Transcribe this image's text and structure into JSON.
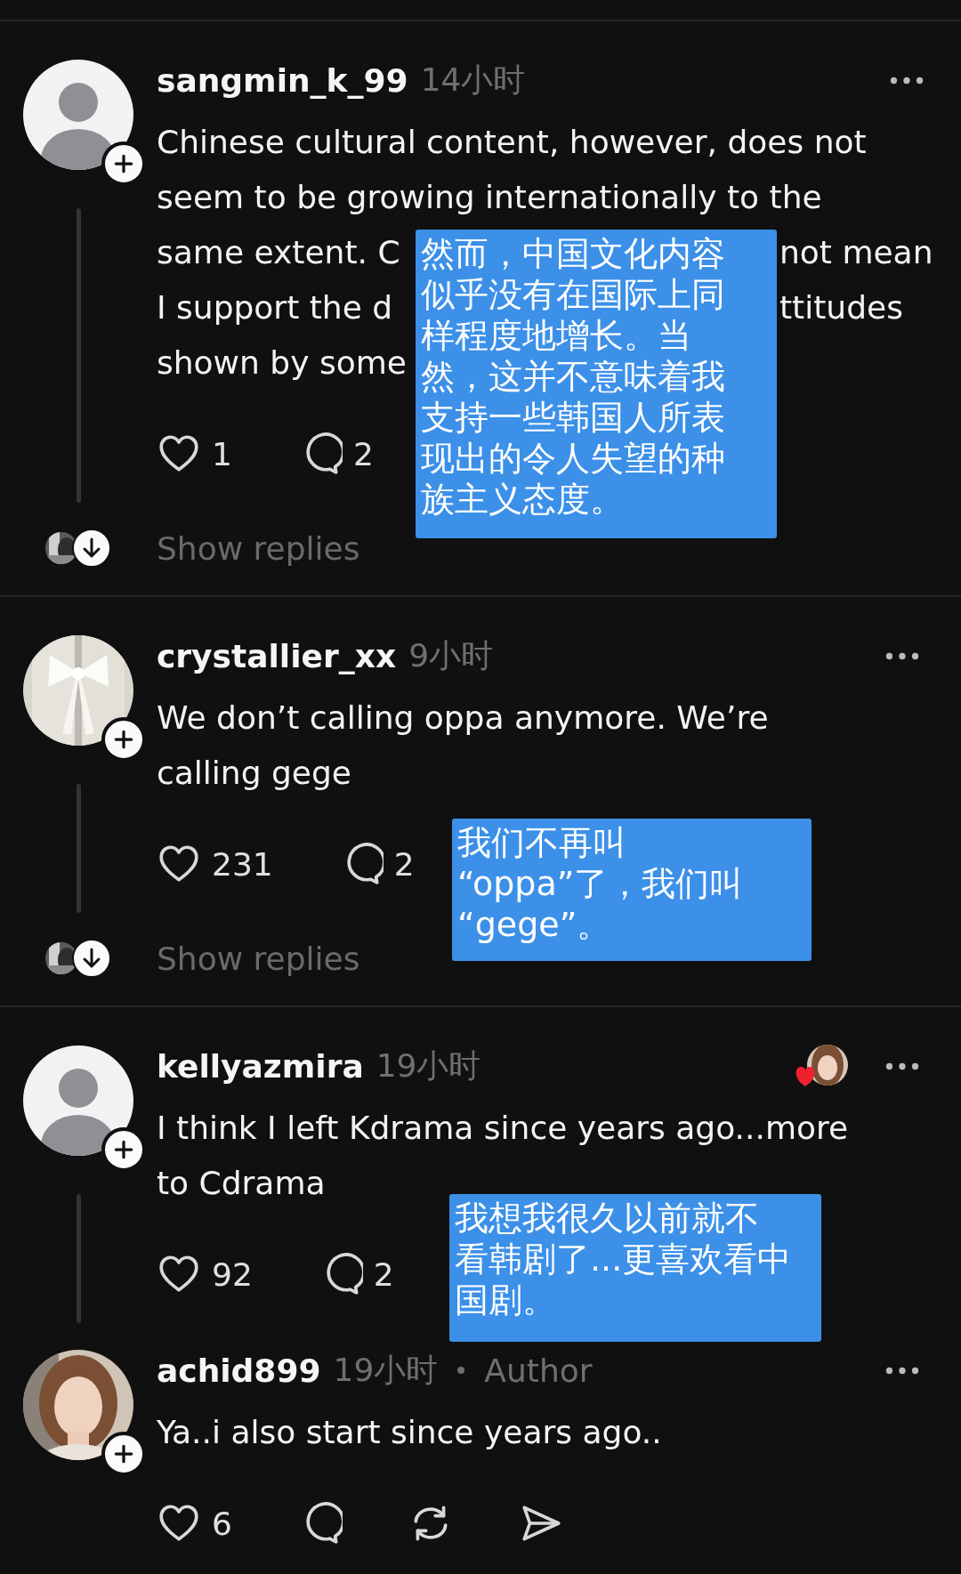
{
  "posts": [
    {
      "kind": "top",
      "username": "sangmin_k_99",
      "time": "14小时",
      "avatar": {
        "kind": "default"
      },
      "thread_line": true,
      "liked_by_author": false,
      "lines": [
        [
          "Chinese cultural content, however, does not"
        ],
        [
          "seem to be growing internationally to the"
        ],
        [
          "same extent. C",
          "not mean"
        ],
        [
          "I support the d",
          "ttitudes"
        ],
        [
          "shown by some"
        ]
      ],
      "likes": "1",
      "replies": "2",
      "show_replies": "Show replies",
      "note": [
        "然而，中国文化内容",
        "似乎没有在国际上同",
        "样程度地增长。当",
        "然，这并不意味着我",
        "支持一些韩国人所表",
        "现出的令人失望的种",
        "族主义态度。"
      ]
    },
    {
      "kind": "top",
      "username": "crystallier_xx",
      "time": "9小时",
      "avatar": {
        "kind": "bow"
      },
      "thread_line": true,
      "liked_by_author": false,
      "lines": [
        [
          "We don’t calling oppa anymore. We’re"
        ],
        [
          "calling gege"
        ]
      ],
      "likes": "231",
      "replies": "2",
      "show_replies": "Show replies",
      "note": [
        "我们不再叫",
        "“oppa”了，我们叫",
        "“gege”。"
      ]
    },
    {
      "kind": "top",
      "username": "kellyazmira",
      "time": "19小时",
      "avatar": {
        "kind": "default"
      },
      "thread_line": true,
      "liked_by_author": true,
      "lines": [
        [
          "I think I left Kdrama since years ago...more"
        ],
        [
          "to Cdrama"
        ]
      ],
      "likes": "92",
      "replies": "2",
      "note": [
        "我想我很久以前就不",
        "看韩剧了...更喜欢看中",
        "国剧。"
      ]
    },
    {
      "kind": "reply",
      "username": "achid899",
      "time": "19小时",
      "author_tag": "Author",
      "avatar": {
        "kind": "person"
      },
      "thread_line": false,
      "liked_by_author": false,
      "lines": [
        [
          "Ya..i  also start since years ago.."
        ]
      ],
      "likes": "6"
    }
  ]
}
